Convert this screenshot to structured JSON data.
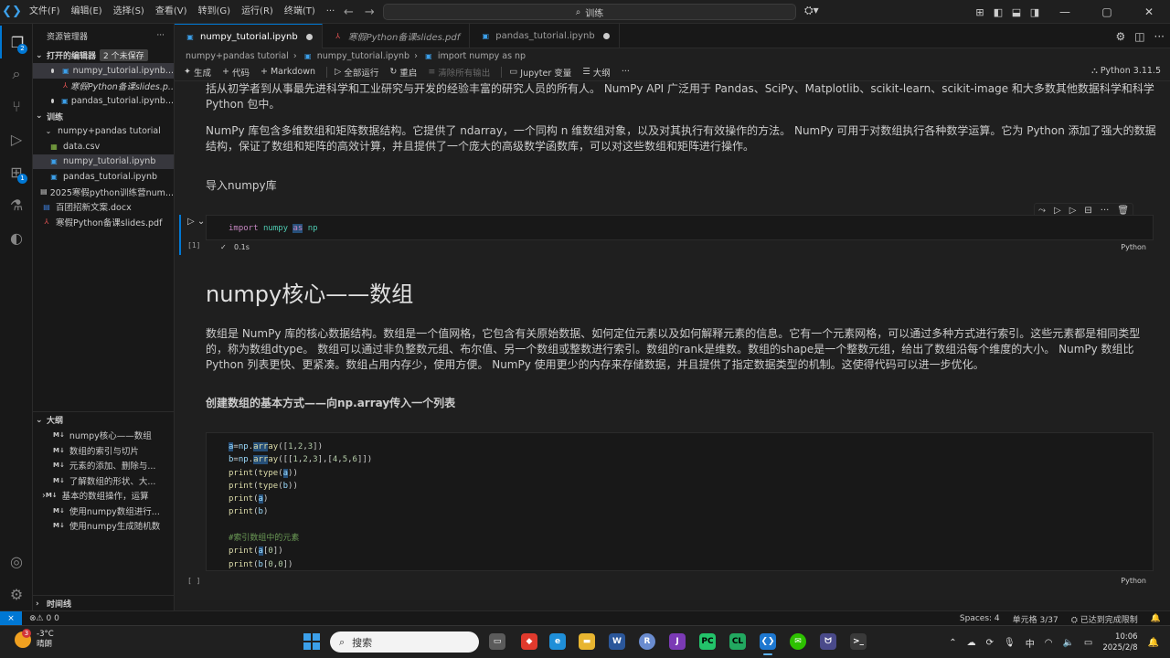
{
  "titlebar": {
    "menu": [
      "文件(F)",
      "编辑(E)",
      "选择(S)",
      "查看(V)",
      "转到(G)",
      "运行(R)",
      "终端(T)",
      "···"
    ],
    "search": "训练"
  },
  "sidebar": {
    "title": "资源管理器",
    "open_editors": {
      "label": "打开的编辑器",
      "badge": "2 个未保存",
      "items": [
        "numpy_tutorial.ipynb...",
        "寒假Python备课slides.p...",
        "pandas_tutorial.ipynb..."
      ]
    },
    "folder": {
      "label": "训练",
      "items": [
        "numpy+pandas tutorial",
        "data.csv",
        "numpy_tutorial.ipynb",
        "pandas_tutorial.ipynb",
        "2025寒假python训练营num...",
        "百团招新文案.docx",
        "寒假Python备课slides.pdf"
      ]
    },
    "outline": {
      "label": "大纲",
      "items": [
        "numpy核心——数组",
        "数组的索引与切片",
        "元素的添加、删除与...",
        "了解数组的形状、大...",
        "基本的数组操作，运算",
        "使用numpy数组进行...",
        "使用numpy生成随机数"
      ]
    },
    "timeline": "时间线"
  },
  "tabs": [
    {
      "label": "numpy_tutorial.ipynb",
      "icon": "notebook-icon"
    },
    {
      "label": "寒假Python备课slides.pdf",
      "icon": "pdf-icon"
    },
    {
      "label": "pandas_tutorial.ipynb",
      "icon": "notebook-icon"
    }
  ],
  "breadcrumb": [
    "numpy+pandas tutorial",
    "numpy_tutorial.ipynb",
    "import numpy as np"
  ],
  "toolbar": {
    "generate": "生成",
    "code": "代码",
    "markdown": "Markdown",
    "run_all": "全部运行",
    "restart": "重启",
    "clear_outputs": "清除所有输出",
    "variables": "Jupyter 变量",
    "outline": "大纲",
    "more": "···",
    "kernel": "Python 3.11.5"
  },
  "notebook": {
    "para1": "括从初学者到从事最先进科学和工业研究与开发的经验丰富的研究人员的所有人。 NumPy API 广泛用于 Pandas、SciPy、Matplotlib、scikit-learn、scikit-image 和大多数其他数据科学和科学 Python 包中。",
    "para2": "NumPy 库包含多维数组和矩阵数据结构。它提供了 ndarray，一个同构 n 维数组对象，以及对其执行有效操作的方法。 NumPy 可用于对数组执行各种数学运算。它为 Python 添加了强大的数据结构，保证了数组和矩阵的高效计算，并且提供了一个庞大的高级数学函数库，可以对这些数组和矩阵进行操作。",
    "import_heading": "导入numpy库",
    "cell1": {
      "exec": "[1]",
      "time": "0.1s",
      "lang": "Python"
    },
    "h1": "numpy核心——数组",
    "para3": "数组是 NumPy 库的核心数据结构。数组是一个值网格，它包含有关原始数据、如何定位元素以及如何解释元素的信息。它有一个元素网格，可以通过多种方式进行索引。这些元素都是相同类型的，称为数组dtype。 数组可以通过非负整数元组、布尔值、另一个数组或整数进行索引。数组的rank是维数。数组的shape是一个整数元组，给出了数组沿每个维度的大小。 NumPy 数组比 Python 列表更快、更紧凑。数组占用内存少，使用方便。 NumPy 使用更少的内存来存储数据，并且提供了指定数据类型的机制。这使得代码可以进一步优化。",
    "bold_heading": "创建数组的基本方式——向np.array传入一个列表",
    "cell2": {
      "exec": "[ ]",
      "lang": "Python"
    }
  },
  "statusbar": {
    "problems": "0  0",
    "spaces": "Spaces: 4",
    "cell": "单元格 3/37",
    "copilot": "已达到完成限制"
  },
  "taskbar": {
    "weather_badge": "3",
    "temp": "-3°C",
    "weather": "晴朗",
    "search": "搜索",
    "ime": "中",
    "time": "10:06",
    "date": "2025/2/8"
  }
}
